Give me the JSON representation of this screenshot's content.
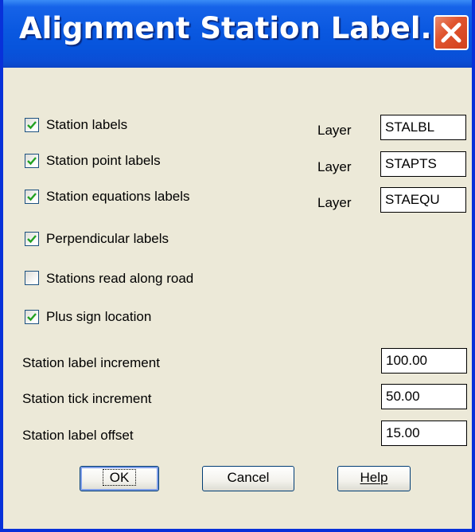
{
  "window": {
    "title": "Alignment Station Label...",
    "close_icon": "close-icon"
  },
  "options": [
    {
      "label": "Station labels",
      "checked": true,
      "layer_label": "Layer",
      "layer_value": "STALBL"
    },
    {
      "label": "Station point labels",
      "checked": true,
      "layer_label": "Layer",
      "layer_value": "STAPTS"
    },
    {
      "label": "Station equations labels",
      "checked": true,
      "layer_label": "Layer",
      "layer_value": "STAEQU"
    },
    {
      "label": "Perpendicular labels",
      "checked": true
    },
    {
      "label": "Stations read along road",
      "checked": false
    },
    {
      "label": "Plus sign location",
      "checked": true
    }
  ],
  "settings": [
    {
      "label": "Station label increment",
      "value": "100.00"
    },
    {
      "label": "Station tick increment",
      "value": "50.00"
    },
    {
      "label": "Station label offset",
      "value": "15.00"
    }
  ],
  "buttons": {
    "ok": "OK",
    "cancel": "Cancel",
    "help": "Help"
  },
  "colors": {
    "titlebar": "#0754dc",
    "dialog_bg": "#ece9d8",
    "close_button": "#e0552f",
    "checkmark": "#21a121"
  }
}
